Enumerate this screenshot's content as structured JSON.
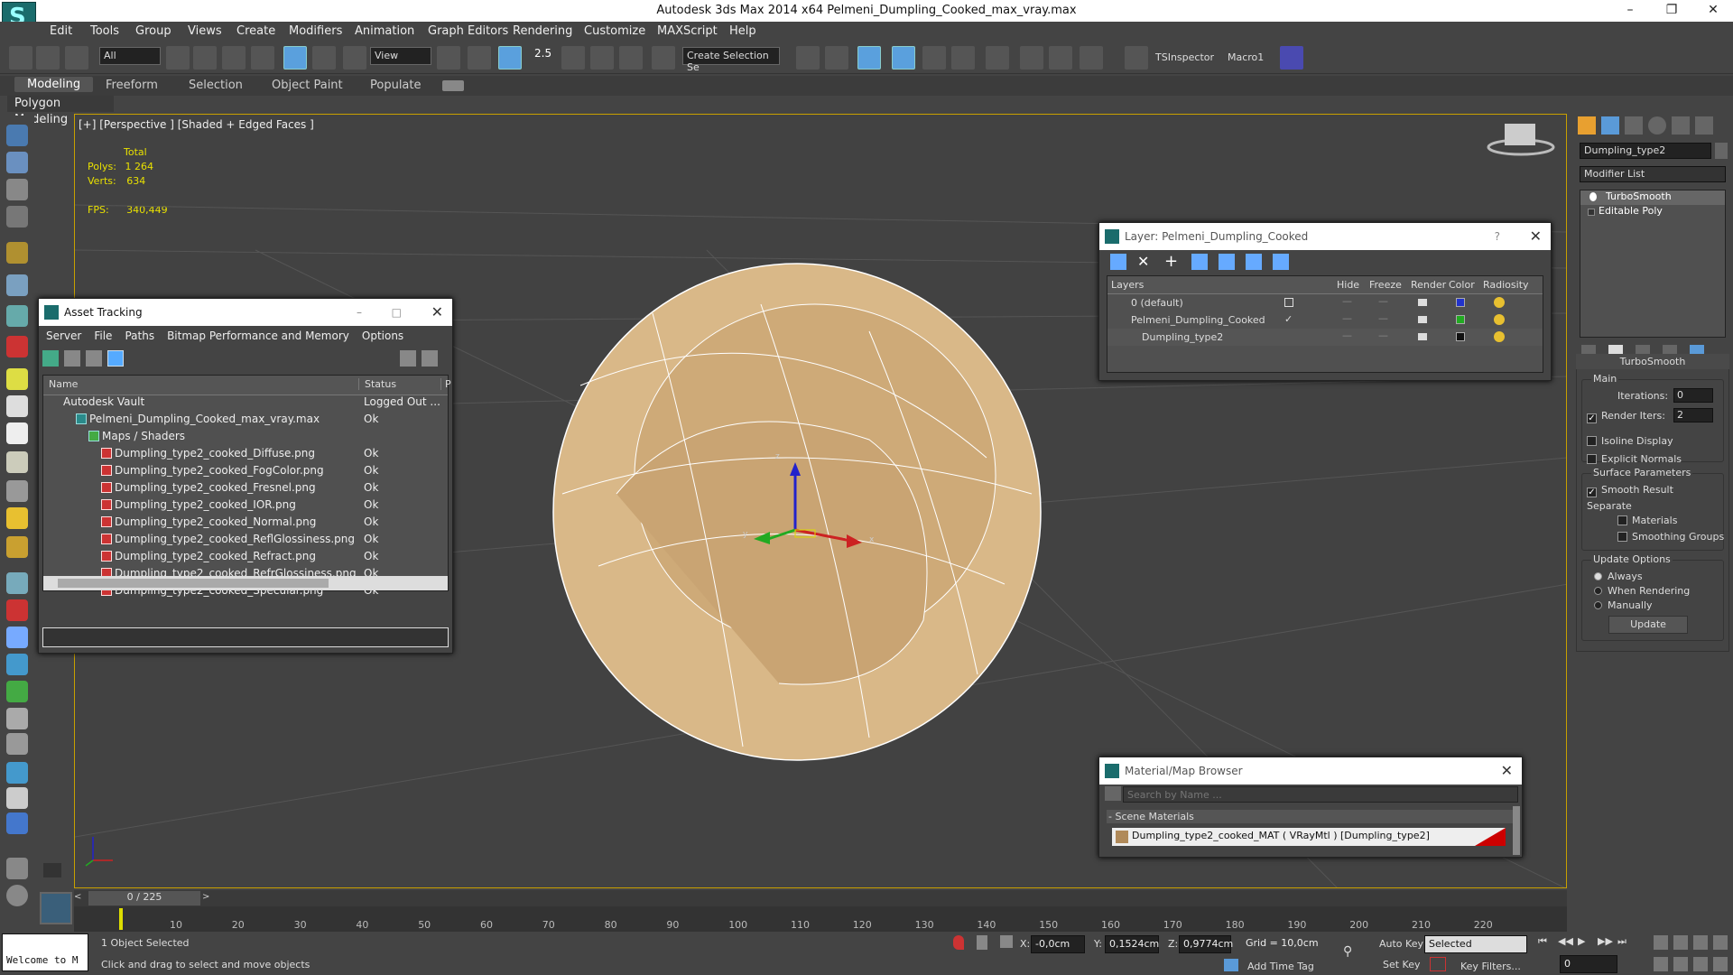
{
  "window": {
    "title": "Autodesk 3ds Max  2014 x64     Pelmeni_Dumpling_Cooked_max_vray.max"
  },
  "menu": [
    "Edit",
    "Tools",
    "Group",
    "Views",
    "Create",
    "Modifiers",
    "Animation",
    "Graph Editors",
    "Rendering",
    "Customize",
    "MAXScript",
    "Help"
  ],
  "toolbar": {
    "selection_filter": "All",
    "ref_coord": "View",
    "selection_set": "Create Selection Se",
    "snap_label": "2.5",
    "tsinspector": "TSInspector",
    "macro": "Macro1"
  },
  "ribbon": {
    "tabs": [
      "Modeling",
      "Freeform",
      "Selection",
      "Object Paint",
      "Populate"
    ],
    "active_tab": "Modeling",
    "panel_label": "Polygon Modeling"
  },
  "viewport": {
    "label": "[+] [Perspective ] [Shaded + Edged Faces ]",
    "stats": {
      "total_label": "Total",
      "polys_label": "Polys:",
      "polys": "1 264",
      "verts_label": "Verts:",
      "verts": "634",
      "fps_label": "FPS:",
      "fps": "340,449"
    },
    "gizmo_labels": {
      "x": "x",
      "y": "y",
      "z": "z"
    }
  },
  "asset_tracking": {
    "title": "Asset Tracking",
    "menu": [
      "Server",
      "File",
      "Paths",
      "Bitmap Performance and Memory",
      "Options"
    ],
    "columns": [
      "Name",
      "Status",
      "P"
    ],
    "rows": [
      {
        "name": "Autodesk Vault",
        "status": "Logged Out ...",
        "level": 1
      },
      {
        "name": "Pelmeni_Dumpling_Cooked_max_vray.max",
        "status": "Ok",
        "level": 2
      },
      {
        "name": "Maps / Shaders",
        "status": "",
        "level": 3
      },
      {
        "name": "Dumpling_type2_cooked_Diffuse.png",
        "status": "Ok",
        "level": 4
      },
      {
        "name": "Dumpling_type2_cooked_FogColor.png",
        "status": "Ok",
        "level": 4
      },
      {
        "name": "Dumpling_type2_cooked_Fresnel.png",
        "status": "Ok",
        "level": 4
      },
      {
        "name": "Dumpling_type2_cooked_IOR.png",
        "status": "Ok",
        "level": 4
      },
      {
        "name": "Dumpling_type2_cooked_Normal.png",
        "status": "Ok",
        "level": 4
      },
      {
        "name": "Dumpling_type2_cooked_ReflGlossiness.png",
        "status": "Ok",
        "level": 4
      },
      {
        "name": "Dumpling_type2_cooked_Refract.png",
        "status": "Ok",
        "level": 4
      },
      {
        "name": "Dumpling_type2_cooked_RefrGlossiness.png",
        "status": "Ok",
        "level": 4
      },
      {
        "name": "Dumpling_type2_cooked_Specular.png",
        "status": "Ok",
        "level": 4
      }
    ]
  },
  "layer_window": {
    "title": "Layer: Pelmeni_Dumpling_Cooked",
    "help": "?",
    "columns": [
      "Layers",
      "Hide",
      "Freeze",
      "Render",
      "Color",
      "Radiosity"
    ],
    "rows": [
      {
        "name": "0 (default)",
        "color": "#2233cc"
      },
      {
        "name": "Pelmeni_Dumpling_Cooked",
        "color": "#22aa22"
      },
      {
        "name": "Dumpling_type2",
        "color": "#111111"
      }
    ]
  },
  "material_browser": {
    "title": "Material/Map Browser",
    "search_placeholder": "Search by Name ...",
    "section": "- Scene Materials",
    "material": "Dumpling_type2_cooked_MAT ( VRayMtl ) [Dumpling_type2]"
  },
  "command_panel": {
    "object_name": "Dumpling_type2",
    "modifier_list": "Modifier List",
    "stack": [
      "TurboSmooth",
      "Editable Poly"
    ],
    "rollout": "TurboSmooth",
    "main_label": "Main",
    "iterations_label": "Iterations:",
    "iterations": "0",
    "render_iters_label": "Render Iters:",
    "render_iters": "2",
    "isoline": "Isoline Display",
    "explicit_normals": "Explicit Normals",
    "surface_params": "Surface Parameters",
    "smooth_result": "Smooth Result",
    "separate": "Separate",
    "materials": "Materials",
    "smoothing_groups": "Smoothing Groups",
    "update_options": "Update Options",
    "always": "Always",
    "when_rendering": "When Rendering",
    "manually": "Manually",
    "update_button": "Update"
  },
  "timeline": {
    "frame": "0 / 225",
    "ticks": [
      "10",
      "20",
      "30",
      "40",
      "50",
      "60",
      "70",
      "80",
      "90",
      "100",
      "110",
      "120",
      "130",
      "140",
      "150",
      "160",
      "170",
      "180",
      "190",
      "200",
      "210",
      "220"
    ]
  },
  "status": {
    "script_listener": "Welcome to M",
    "selection": "1 Object Selected",
    "prompt": "Click and drag to select and move objects",
    "x_label": "X:",
    "x": "-0,0cm",
    "y_label": "Y:",
    "y": "0,1524cm",
    "z_label": "Z:",
    "z": "0,9774cm",
    "grid": "Grid = 10,0cm",
    "add_time_tag": "Add Time Tag",
    "auto_key": "Auto Key",
    "set_key": "Set Key",
    "key_mode": "Selected",
    "key_filters": "Key Filters...",
    "current_frame": "0"
  }
}
